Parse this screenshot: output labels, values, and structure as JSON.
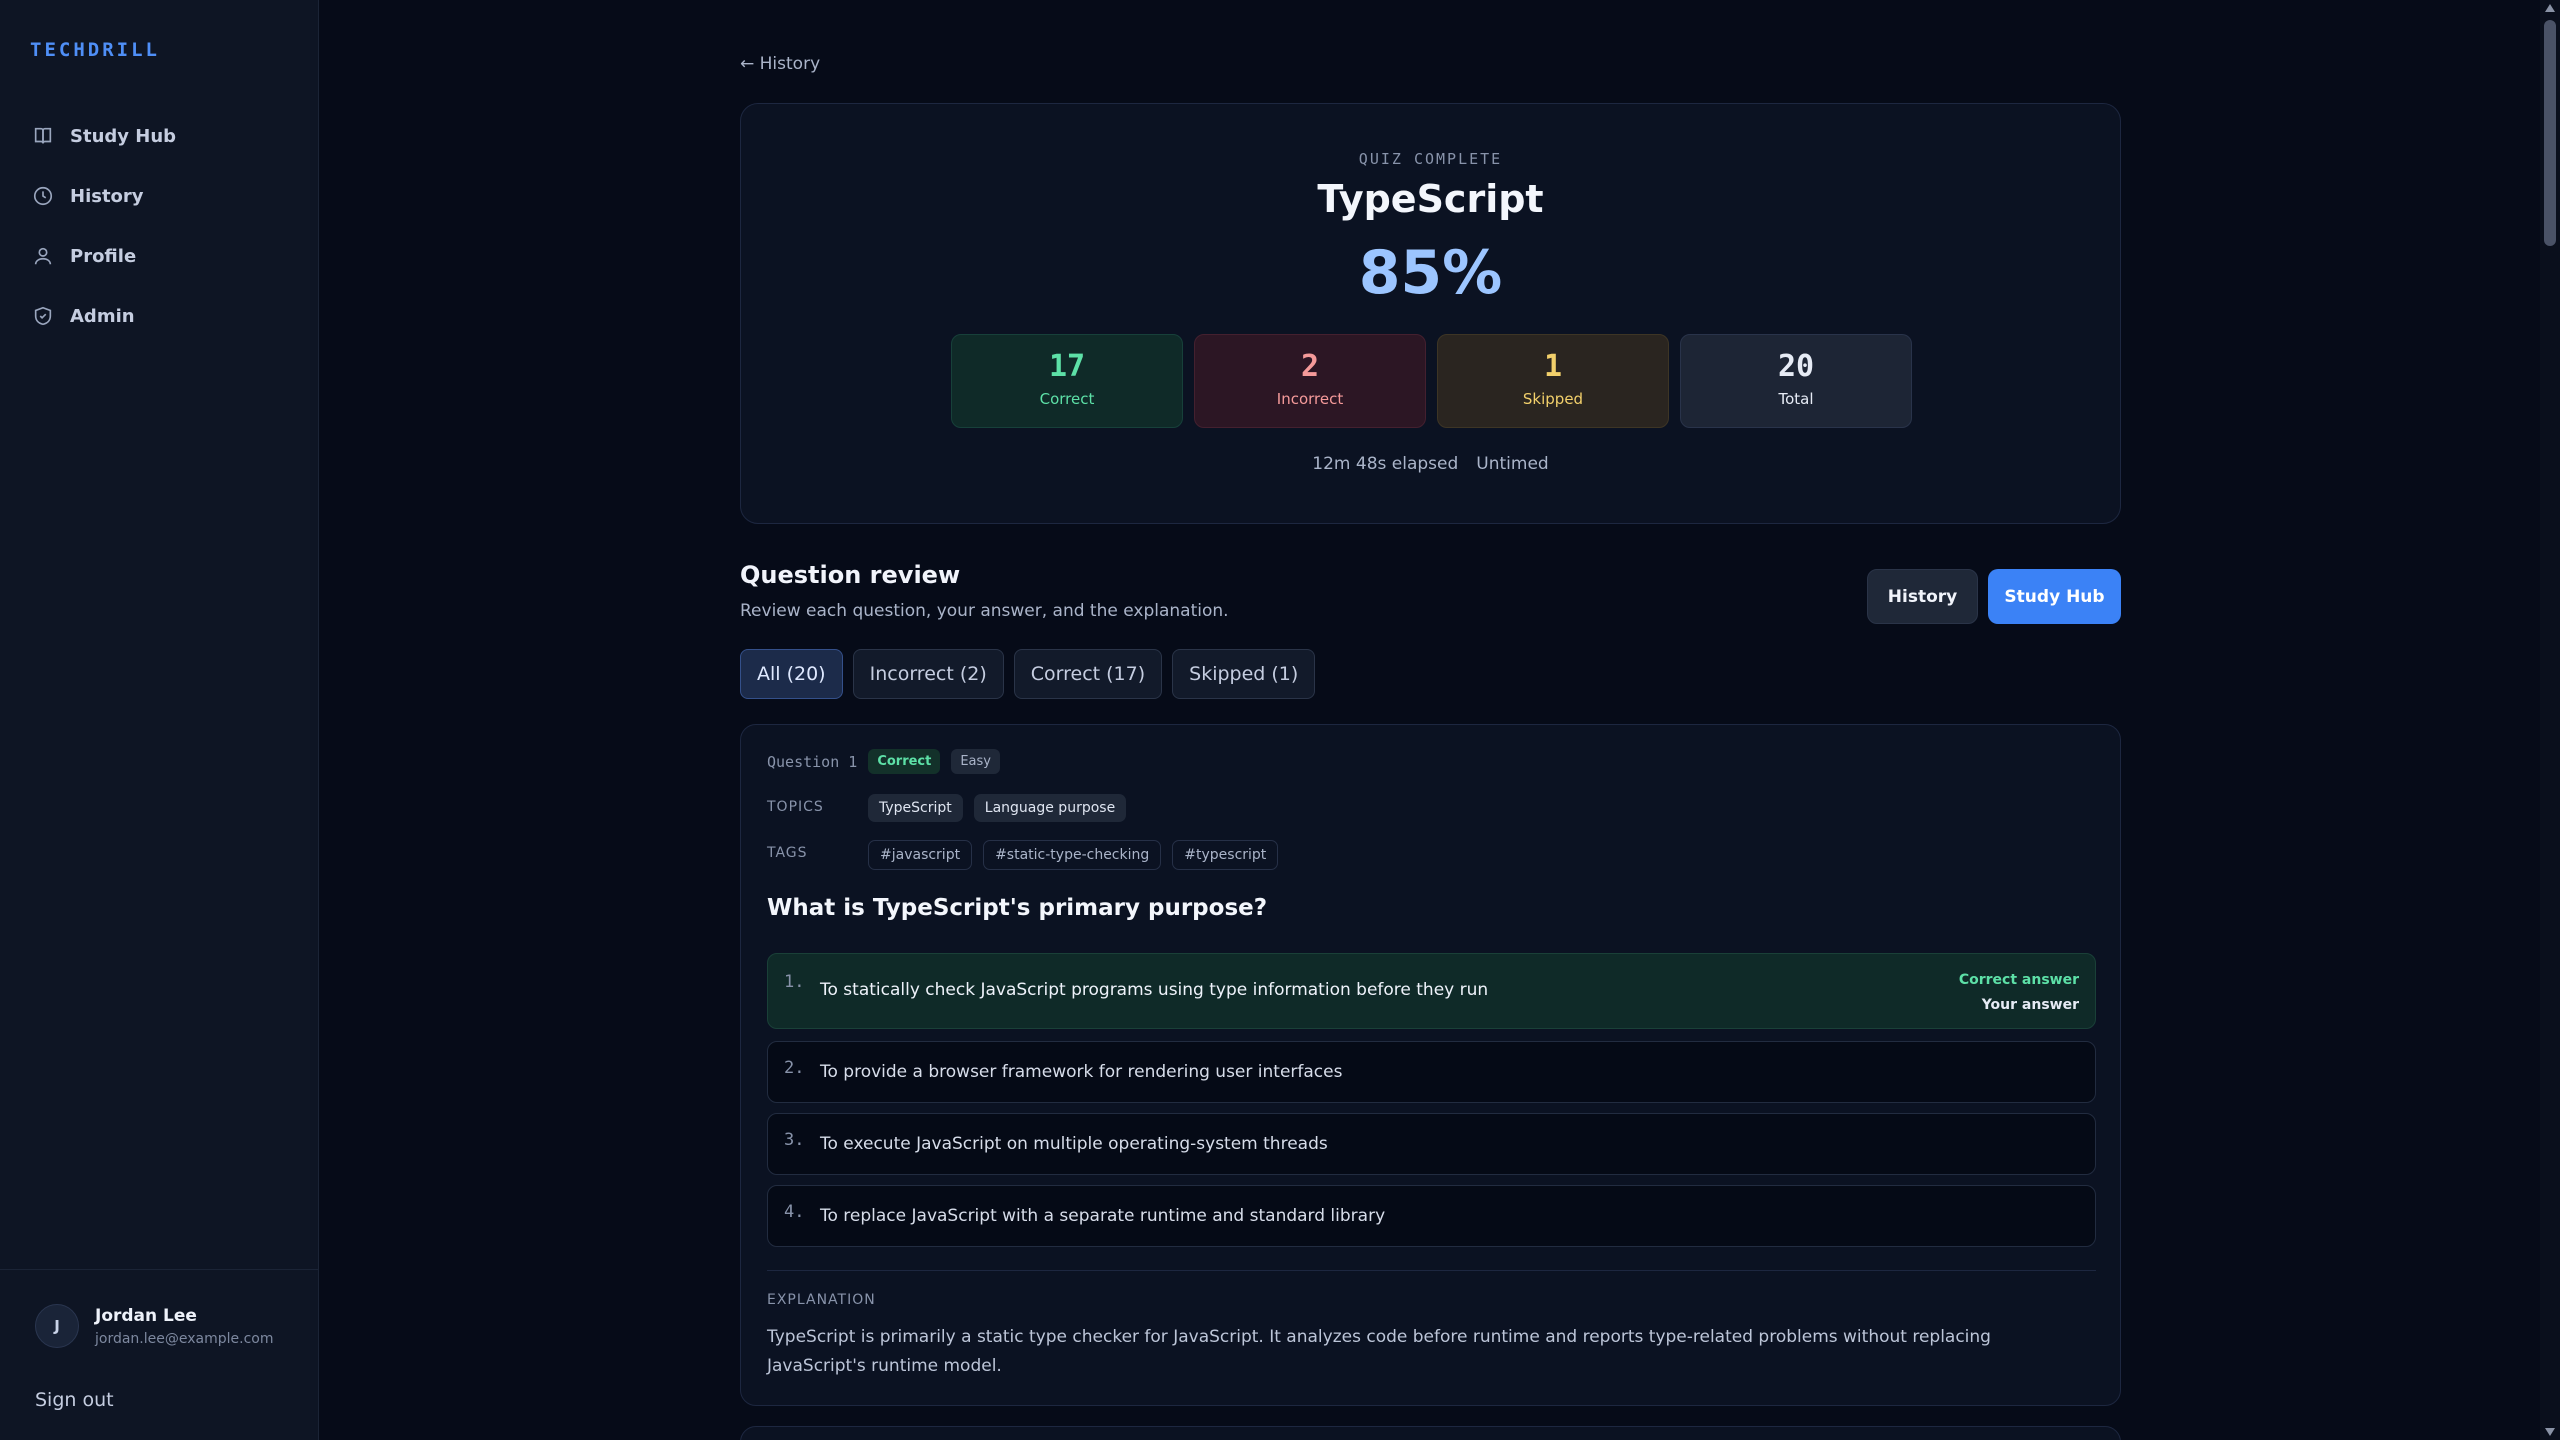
{
  "brand": "TECHDRILL",
  "nav": [
    {
      "label": "Study Hub",
      "icon": "book-icon"
    },
    {
      "label": "History",
      "icon": "clock-icon"
    },
    {
      "label": "Profile",
      "icon": "user-icon"
    },
    {
      "label": "Admin",
      "icon": "shield-icon"
    }
  ],
  "user": {
    "initial": "J",
    "name": "Jordan Lee",
    "email": "jordan.lee@example.com"
  },
  "sign_out": "Sign out",
  "back_link": "← History",
  "summary": {
    "eyebrow": "QUIZ COMPLETE",
    "title": "TypeScript",
    "score": "85%",
    "stats": {
      "correct": {
        "value": "17",
        "label": "Correct"
      },
      "incorrect": {
        "value": "2",
        "label": "Incorrect"
      },
      "skipped": {
        "value": "1",
        "label": "Skipped"
      },
      "total": {
        "value": "20",
        "label": "Total"
      }
    },
    "elapsed": "12m 48s elapsed",
    "timing_mode": "Untimed"
  },
  "review": {
    "title": "Question review",
    "subtitle": "Review each question, your answer, and the explanation.",
    "history_button": "History",
    "studyhub_button": "Study Hub",
    "filters": [
      "All (20)",
      "Incorrect (2)",
      "Correct (17)",
      "Skipped (1)"
    ],
    "active_filter": "All (20)"
  },
  "question": {
    "number_label": "Question 1",
    "status": "Correct",
    "difficulty": "Easy",
    "topics_label": "TOPICS",
    "topics": [
      "TypeScript",
      "Language purpose"
    ],
    "tags_label": "TAGS",
    "tags": [
      "#javascript",
      "#static-type-checking",
      "#typescript"
    ],
    "text": "What is TypeScript's primary purpose?",
    "options": [
      {
        "num": "1.",
        "text": "To statically check JavaScript programs using type information before they run"
      },
      {
        "num": "2.",
        "text": "To provide a browser framework for rendering user interfaces"
      },
      {
        "num": "3.",
        "text": "To execute JavaScript on multiple operating-system threads"
      },
      {
        "num": "4.",
        "text": "To replace JavaScript with a separate runtime and standard library"
      }
    ],
    "correct_answer_label": "Correct answer",
    "your_answer_label": "Your answer",
    "explanation_label": "EXPLANATION",
    "explanation": "TypeScript is primarily a static type checker for JavaScript. It analyzes code before runtime and reports type-related problems without replacing JavaScript's runtime model."
  },
  "colors": {
    "accent": "#3b82f6",
    "correct": "#5de0a7",
    "incorrect": "#f59a9a",
    "skipped": "#f2d06b",
    "background": "#060b18"
  }
}
